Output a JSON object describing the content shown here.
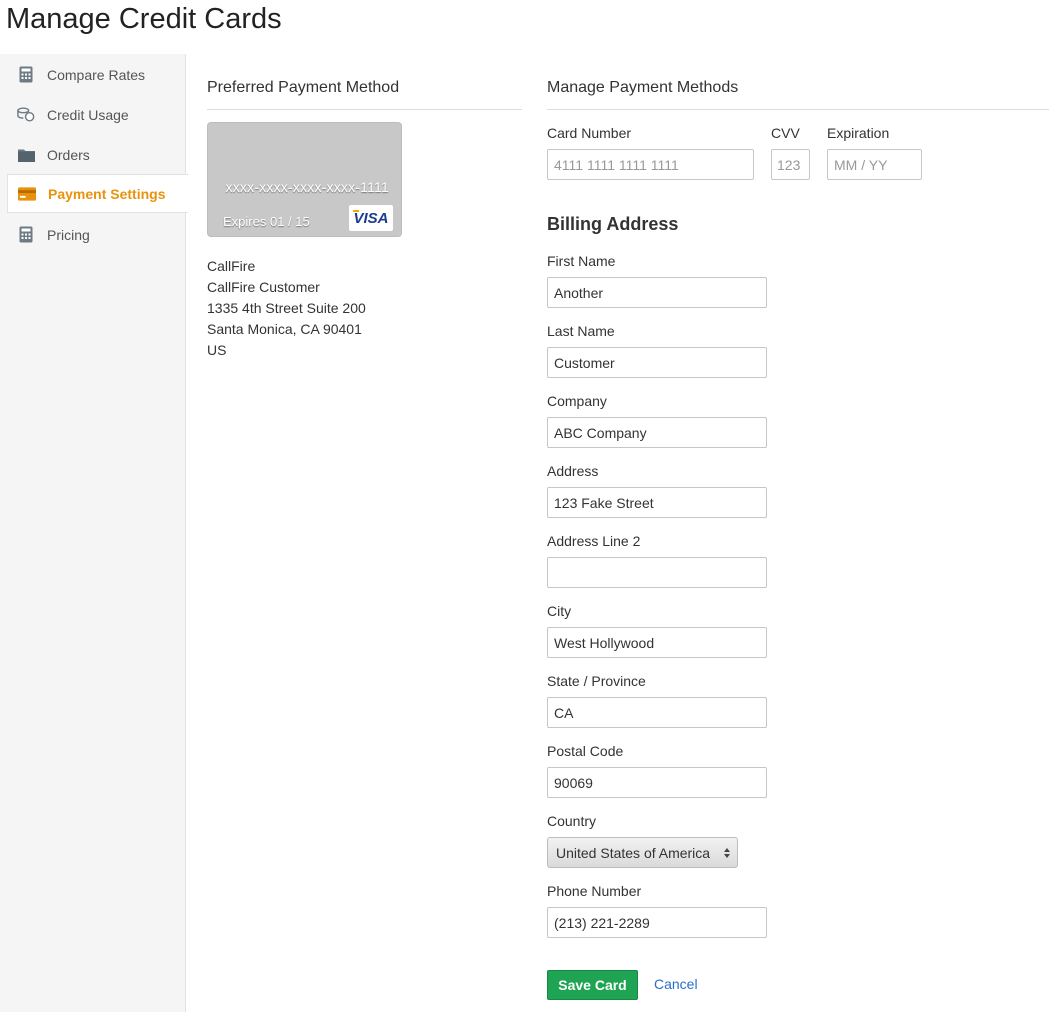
{
  "page": {
    "title": "Manage Credit Cards"
  },
  "sidebar": {
    "items": [
      {
        "label": "Compare Rates",
        "icon": "calculator-icon"
      },
      {
        "label": "Credit Usage",
        "icon": "coins-icon"
      },
      {
        "label": "Orders",
        "icon": "folder-icon"
      },
      {
        "label": "Payment Settings",
        "icon": "credit-card-icon",
        "active": true
      },
      {
        "label": "Pricing",
        "icon": "calculator-icon"
      }
    ]
  },
  "preferred": {
    "title": "Preferred Payment Method",
    "card": {
      "number": "xxxx-xxxx-xxxx-xxxx-1111",
      "expires": "Expires 01 / 15",
      "brand": "VISA"
    },
    "address": [
      "CallFire",
      "CallFire Customer",
      "1335 4th Street Suite 200",
      "Santa Monica, CA 90401",
      "US"
    ]
  },
  "manage": {
    "title": "Manage Payment Methods",
    "card_number": {
      "label": "Card Number",
      "placeholder": "4111 1111 1111 1111"
    },
    "cvv": {
      "label": "CVV",
      "placeholder": "123"
    },
    "expiration": {
      "label": "Expiration",
      "placeholder": "MM / YY"
    }
  },
  "billing": {
    "title": "Billing Address",
    "first_name": {
      "label": "First Name",
      "value": "Another"
    },
    "last_name": {
      "label": "Last Name",
      "value": "Customer"
    },
    "company": {
      "label": "Company",
      "value": "ABC Company"
    },
    "address": {
      "label": "Address",
      "value": "123 Fake Street"
    },
    "address2": {
      "label": "Address Line 2",
      "value": ""
    },
    "city": {
      "label": "City",
      "value": "West Hollywood"
    },
    "state": {
      "label": "State / Province",
      "value": "CA"
    },
    "postal": {
      "label": "Postal Code",
      "value": "90069"
    },
    "country": {
      "label": "Country",
      "value": "United States of America"
    },
    "phone": {
      "label": "Phone Number",
      "value": "(213) 221-2289"
    }
  },
  "actions": {
    "save_label": "Save Card",
    "cancel_label": "Cancel"
  },
  "colors": {
    "accent": "#e8930c",
    "save_button": "#1ea453",
    "link": "#2a6fc9"
  }
}
